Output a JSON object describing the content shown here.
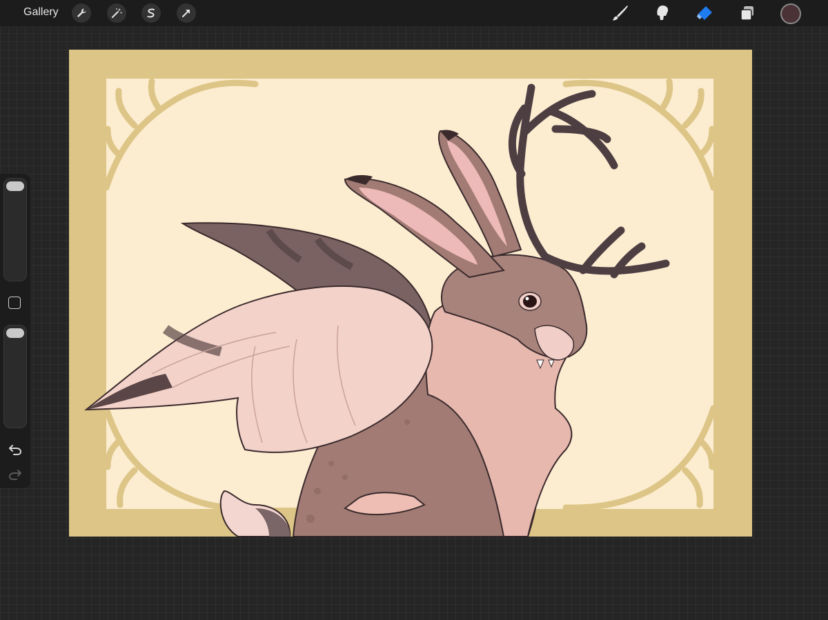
{
  "topbar": {
    "gallery_label": "Gallery",
    "actions": [
      {
        "name": "wrench-icon"
      },
      {
        "name": "magic-wand-icon"
      },
      {
        "name": "selection-s-icon"
      },
      {
        "name": "transform-arrow-icon"
      }
    ],
    "tools": [
      {
        "name": "brush-icon"
      },
      {
        "name": "smudge-icon"
      },
      {
        "name": "eraser-icon",
        "active": true
      },
      {
        "name": "layers-icon"
      }
    ],
    "current_color": "#4a3236"
  },
  "sidebar": {
    "brush_size_level": 0.02,
    "opacity_level": 0.02,
    "buttons": [
      "modify-square-icon",
      "undo-icon",
      "redo-icon"
    ]
  },
  "colors": {
    "background": "#252525",
    "toolbar": "#1c1c1c",
    "frame": "#dcc586",
    "canvas_inner": "#fcecd0",
    "fur": "#a17b74",
    "ear_inner": "#edb9b9",
    "antler": "#4d3e42",
    "wing_light": "#f3d2ca",
    "wing_dark": "#7a6262",
    "active_tool": "#1e7bf0"
  }
}
